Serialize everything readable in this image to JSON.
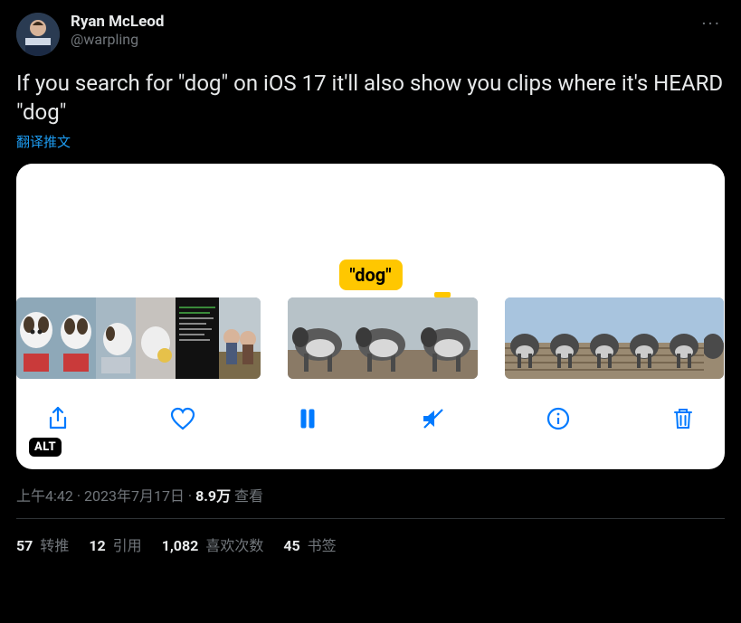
{
  "author": {
    "display_name": "Ryan McLeod",
    "handle": "@warpling"
  },
  "more_label": "···",
  "tweet_text": "If you search for \"dog\" on iOS 17 it'll also show you clips where it's HEARD \"dog\"",
  "translate_label": "翻译推文",
  "media": {
    "search_term_label": "\"dog\"",
    "alt_badge": "ALT",
    "toolbar": {
      "share": "Share",
      "like": "Like",
      "pause": "Pause",
      "mute": "Mute",
      "info": "Info",
      "trash": "Delete"
    }
  },
  "meta": {
    "time": "上午4:42",
    "dot1": " · ",
    "date": "2023年7月17日",
    "dot2": " · ",
    "views_count": "8.9万",
    "views_label": " 查看"
  },
  "engagements": {
    "retweets": {
      "count": "57",
      "label": " 转推"
    },
    "quotes": {
      "count": "12",
      "label": " 引用"
    },
    "likes": {
      "count": "1,082",
      "label": " 喜欢次数"
    },
    "bookmarks": {
      "count": "45",
      "label": " 书签"
    }
  }
}
